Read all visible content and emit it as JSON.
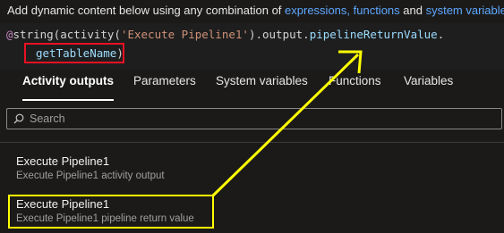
{
  "header": {
    "prefix": "Add dynamic content below using any combination of ",
    "link_expressions": "expressions, functions",
    "connector": " and ",
    "link_system_variables": "system variables"
  },
  "editor": {
    "at": "@",
    "fn_open": "string(activity(",
    "str": "'Execute Pipeline1'",
    "mid": ").output.",
    "prop1": "pipelineReturnValue",
    "dot": ".",
    "prop2": "getTableName",
    "close": ")"
  },
  "tabs": [
    {
      "label": "Activity outputs",
      "active": true
    },
    {
      "label": "Parameters",
      "active": false
    },
    {
      "label": "System variables",
      "active": false
    },
    {
      "label": "Functions",
      "active": false
    },
    {
      "label": "Variables",
      "active": false
    }
  ],
  "search": {
    "placeholder": "Search"
  },
  "outputs": [
    {
      "title": "Execute Pipeline1",
      "description": "Execute Pipeline1 activity output"
    },
    {
      "title": "Execute Pipeline1",
      "description": "Execute Pipeline1 pipeline return value"
    }
  ],
  "colors": {
    "highlight_red": "#e81123",
    "highlight_yellow": "#ffff00",
    "link": "#5fa8ff"
  }
}
